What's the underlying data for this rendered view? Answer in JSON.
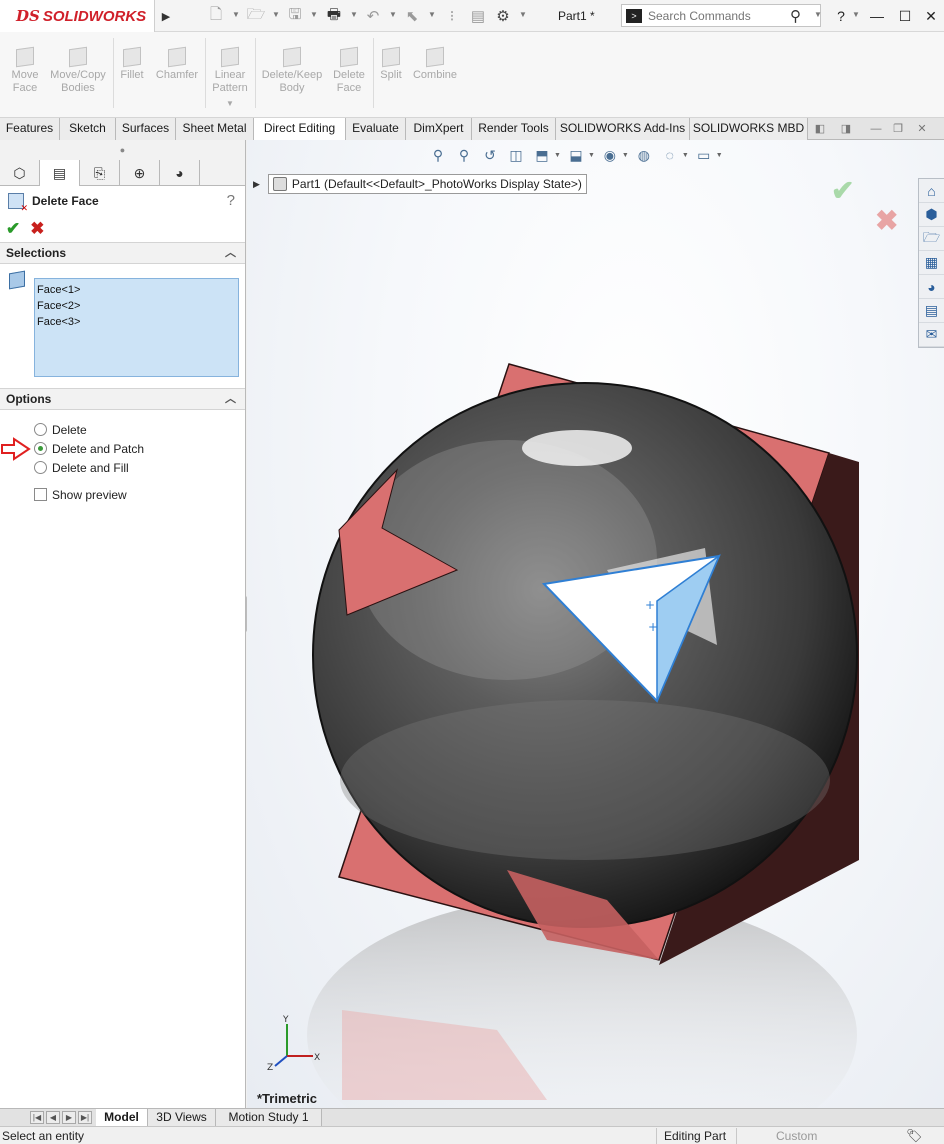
{
  "app": {
    "brand_mark": "DS",
    "brand_name": "SOLIDWORKS",
    "document_title": "Part1 *"
  },
  "search": {
    "placeholder": "Search Commands"
  },
  "command_manager": [
    {
      "label": "Move\nFace"
    },
    {
      "label": "Move/Copy\nBodies"
    },
    {
      "label": "Fillet"
    },
    {
      "label": "Chamfer"
    },
    {
      "label": "Linear\nPattern"
    },
    {
      "label": "Delete/Keep\nBody"
    },
    {
      "label": "Delete\nFace"
    },
    {
      "label": "Split"
    },
    {
      "label": "Combine"
    }
  ],
  "tabs": [
    {
      "label": "Features"
    },
    {
      "label": "Sketch"
    },
    {
      "label": "Surfaces"
    },
    {
      "label": "Sheet Metal"
    },
    {
      "label": "Direct Editing",
      "active": true
    },
    {
      "label": "Evaluate"
    },
    {
      "label": "DimXpert"
    },
    {
      "label": "Render Tools"
    },
    {
      "label": "SOLIDWORKS Add-Ins"
    },
    {
      "label": "SOLIDWORKS MBD"
    }
  ],
  "property_manager": {
    "title": "Delete Face",
    "help_label": "?",
    "selections": {
      "heading": "Selections",
      "items": [
        "Face<1>",
        "Face<2>",
        "Face<3>"
      ]
    },
    "options": {
      "heading": "Options",
      "choices": [
        {
          "label": "Delete",
          "selected": false
        },
        {
          "label": "Delete and Patch",
          "selected": true
        },
        {
          "label": "Delete and Fill",
          "selected": false
        }
      ],
      "show_preview_label": "Show preview",
      "show_preview_checked": false
    }
  },
  "viewport": {
    "tree_flyout": {
      "part": "Part1",
      "config": "(Default<<Default>_PhotoWorks Display State>)"
    },
    "view_orientation": "*Trimetric",
    "triad": {
      "x": "X",
      "y": "Y",
      "z": "Z"
    }
  },
  "bottom_tabs": [
    {
      "label": "Model",
      "active": true
    },
    {
      "label": "3D Views"
    },
    {
      "label": "Motion Study 1"
    }
  ],
  "status": {
    "message": "Select an entity",
    "mode": "Editing Part",
    "units": "Custom"
  },
  "colors": {
    "cube_face": "#d97070",
    "sphere": "#5a5a5a",
    "selected_face": "#9ecdf2",
    "accent_red": "#d0202a"
  }
}
